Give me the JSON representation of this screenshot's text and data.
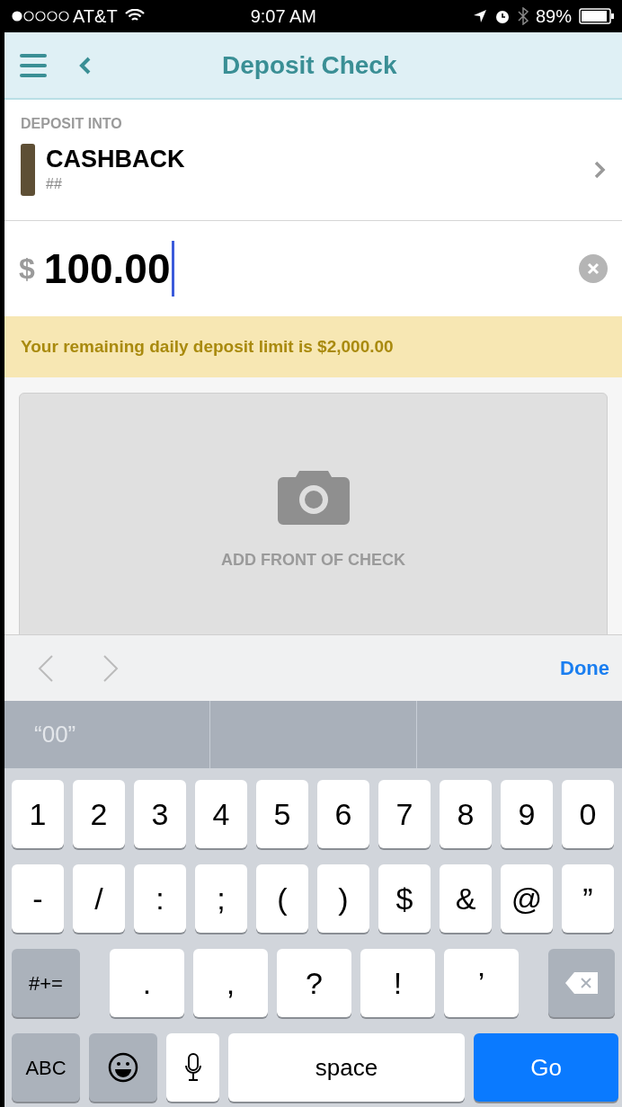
{
  "status_bar": {
    "carrier": "AT&T",
    "time": "9:07 AM",
    "battery": "89%"
  },
  "nav": {
    "title": "Deposit Check"
  },
  "deposit": {
    "label": "DEPOSIT INTO",
    "account_name": "CASHBACK",
    "account_number": "##"
  },
  "amount": {
    "currency": "$",
    "value": "100.00"
  },
  "notice": "Your remaining daily deposit limit is $2,000.00",
  "check": {
    "label": "ADD FRONT OF CHECK"
  },
  "toolbar": {
    "done": "Done"
  },
  "suggestions": [
    {
      "text": "“00”"
    }
  ],
  "keyboard": [
    [
      {
        "kind": "char",
        "label": "1"
      },
      {
        "kind": "char",
        "label": "2"
      },
      {
        "kind": "char",
        "label": "3"
      },
      {
        "kind": "char",
        "label": "4"
      },
      {
        "kind": "char",
        "label": "5"
      },
      {
        "kind": "char",
        "label": "6"
      },
      {
        "kind": "char",
        "label": "7"
      },
      {
        "kind": "char",
        "label": "8"
      },
      {
        "kind": "char",
        "label": "9"
      },
      {
        "kind": "char",
        "label": "0"
      }
    ],
    [
      {
        "kind": "char",
        "label": "-"
      },
      {
        "kind": "char",
        "label": "/"
      },
      {
        "kind": "char",
        "label": ":"
      },
      {
        "kind": "char",
        "label": ";"
      },
      {
        "kind": "char",
        "label": "("
      },
      {
        "kind": "char",
        "label": ")"
      },
      {
        "kind": "char",
        "label": "$"
      },
      {
        "kind": "char",
        "label": "&"
      },
      {
        "kind": "char",
        "label": "@"
      },
      {
        "kind": "char",
        "label": "”"
      }
    ],
    [
      {
        "kind": "mode",
        "label": "#+="
      },
      {
        "kind": "punct",
        "label": "."
      },
      {
        "kind": "punct",
        "label": ","
      },
      {
        "kind": "punct",
        "label": "?"
      },
      {
        "kind": "punct",
        "label": "!"
      },
      {
        "kind": "punct",
        "label": "’"
      },
      {
        "kind": "delete"
      }
    ],
    [
      {
        "kind": "mode",
        "label": "ABC"
      },
      {
        "kind": "emoji"
      },
      {
        "kind": "mic"
      },
      {
        "kind": "space",
        "label": "space"
      },
      {
        "kind": "go",
        "label": "Go"
      }
    ]
  ]
}
